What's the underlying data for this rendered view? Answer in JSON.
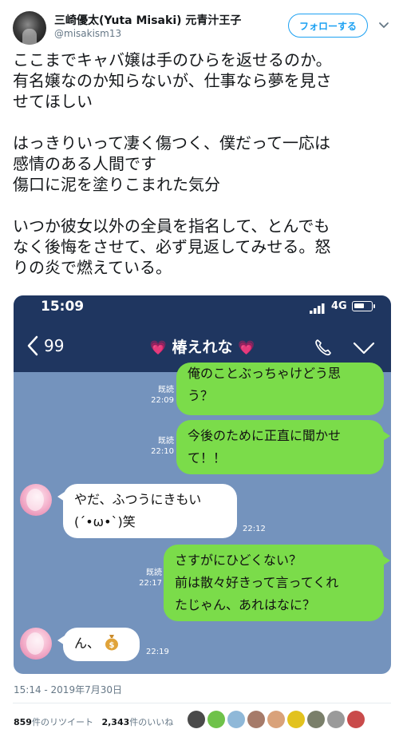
{
  "header": {
    "display_name": "三崎優太(Yuta Misaki) 元青汁王子",
    "handle": "@misakism13",
    "follow_label": "フォローする"
  },
  "tweet": {
    "paragraphs": [
      [
        "ここまでキャバ嬢は手のひらを返せるのか。",
        "有名嬢なのか知らないが、仕事なら夢を見さ",
        "せてほしい"
      ],
      [
        "はっきりいって凄く傷つく、僕だって一応は",
        "感情のある人間です",
        "傷口に泥を塗りこまれた気分"
      ],
      [
        "いつか彼女以外の全員を指名して、とんでも",
        "なく後悔をさせて、必ず見返してみせる。怒",
        "りの炎で燃えている。"
      ]
    ],
    "timestamp": "15:14 - 2019年7月30日"
  },
  "screenshot": {
    "status_time": "15:09",
    "network": "4G",
    "back_count": "99",
    "chat_title": "椿えれな",
    "title_emoji": "💗",
    "messages": [
      {
        "from": "me",
        "lines": [
          "俺のことぶっちゃけどう思",
          "う？"
        ],
        "read": "既読",
        "time": "22:09"
      },
      {
        "from": "me",
        "lines": [
          "今後のために正直に聞かせ",
          "て！！"
        ],
        "read": "既読",
        "time": "22:10"
      },
      {
        "from": "them",
        "lines": [
          "やだ、ふつうにきもい",
          "(´•ω•`)笑"
        ],
        "time": "22:12"
      },
      {
        "from": "me",
        "lines": [
          "さすがにひどくない？",
          "前は散々好きって言ってくれ",
          "たじゃん、あれはなに？"
        ],
        "read": "既読",
        "time": "22:17"
      },
      {
        "from": "them",
        "lines": [
          "ん、"
        ],
        "emoji": "money-bag",
        "time": "22:19"
      }
    ]
  },
  "stats": {
    "retweets_count": "859",
    "retweets_label": "件のリツイート",
    "likes_count": "2,343",
    "likes_label": "件のいいね"
  },
  "colors": {
    "twitter_blue": "#1da1f2",
    "line_header": "#1f3660",
    "line_bg": "#7493bd",
    "line_green": "#7bdc4a"
  }
}
